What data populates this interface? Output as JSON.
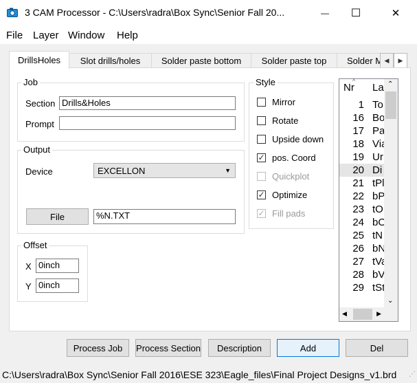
{
  "window": {
    "title": "3 CAM Processor - C:\\Users\\radra\\Box Sync\\Senior Fall 20...",
    "minimize_symbol": "—",
    "maximize_symbol": "☐",
    "close_symbol": "✕"
  },
  "menu": [
    "File",
    "Layer",
    "Window",
    "Help"
  ],
  "tabs": [
    "DrillsHoles",
    "Slot drills/holes",
    "Solder paste bottom",
    "Solder paste top",
    "Solder M"
  ],
  "job": {
    "title": "Job",
    "section_label": "Section",
    "section_value": "Drills&Holes",
    "prompt_label": "Prompt",
    "prompt_value": ""
  },
  "output": {
    "title": "Output",
    "device_label": "Device",
    "device_value": "EXCELLON",
    "file_button": "File",
    "file_value": "%N.TXT"
  },
  "offset": {
    "title": "Offset",
    "x_label": "X",
    "x_value": "0inch",
    "y_label": "Y",
    "y_value": "0inch"
  },
  "style": {
    "title": "Style",
    "options": [
      {
        "label": "Mirror",
        "checked": false,
        "disabled": false
      },
      {
        "label": "Rotate",
        "checked": false,
        "disabled": false
      },
      {
        "label": "Upside down",
        "checked": false,
        "disabled": false
      },
      {
        "label": "pos. Coord",
        "checked": true,
        "disabled": false
      },
      {
        "label": "Quickplot",
        "checked": false,
        "disabled": true
      },
      {
        "label": "Optimize",
        "checked": true,
        "disabled": false
      },
      {
        "label": "Fill pads",
        "checked": true,
        "disabled": true
      }
    ]
  },
  "layers": {
    "col_nr": "Nr",
    "col_name": "La",
    "rows": [
      {
        "nr": "1",
        "name": "To"
      },
      {
        "nr": "16",
        "name": "Bo"
      },
      {
        "nr": "17",
        "name": "Pa"
      },
      {
        "nr": "18",
        "name": "Via"
      },
      {
        "nr": "19",
        "name": "Ur"
      },
      {
        "nr": "20",
        "name": "Di"
      },
      {
        "nr": "21",
        "name": "tPl"
      },
      {
        "nr": "22",
        "name": "bP"
      },
      {
        "nr": "23",
        "name": "tO"
      },
      {
        "nr": "24",
        "name": "bO"
      },
      {
        "nr": "25",
        "name": "tN"
      },
      {
        "nr": "26",
        "name": "bN"
      },
      {
        "nr": "27",
        "name": "tVa"
      },
      {
        "nr": "28",
        "name": "bV"
      },
      {
        "nr": "29",
        "name": "tSt"
      }
    ],
    "selected_index": 5
  },
  "buttons": {
    "process_job": "Process Job",
    "process_section": "Process Section",
    "description": "Description",
    "add": "Add",
    "del": "Del"
  },
  "status": "C:\\Users\\radra\\Box Sync\\Senior Fall 2016\\ESE 323\\Eagle_files\\Final Project Designs_v1.brd",
  "colors": {
    "accent": "#0078d7",
    "window_bg": "#f0f0f0",
    "panel_bg": "#ffffff"
  }
}
